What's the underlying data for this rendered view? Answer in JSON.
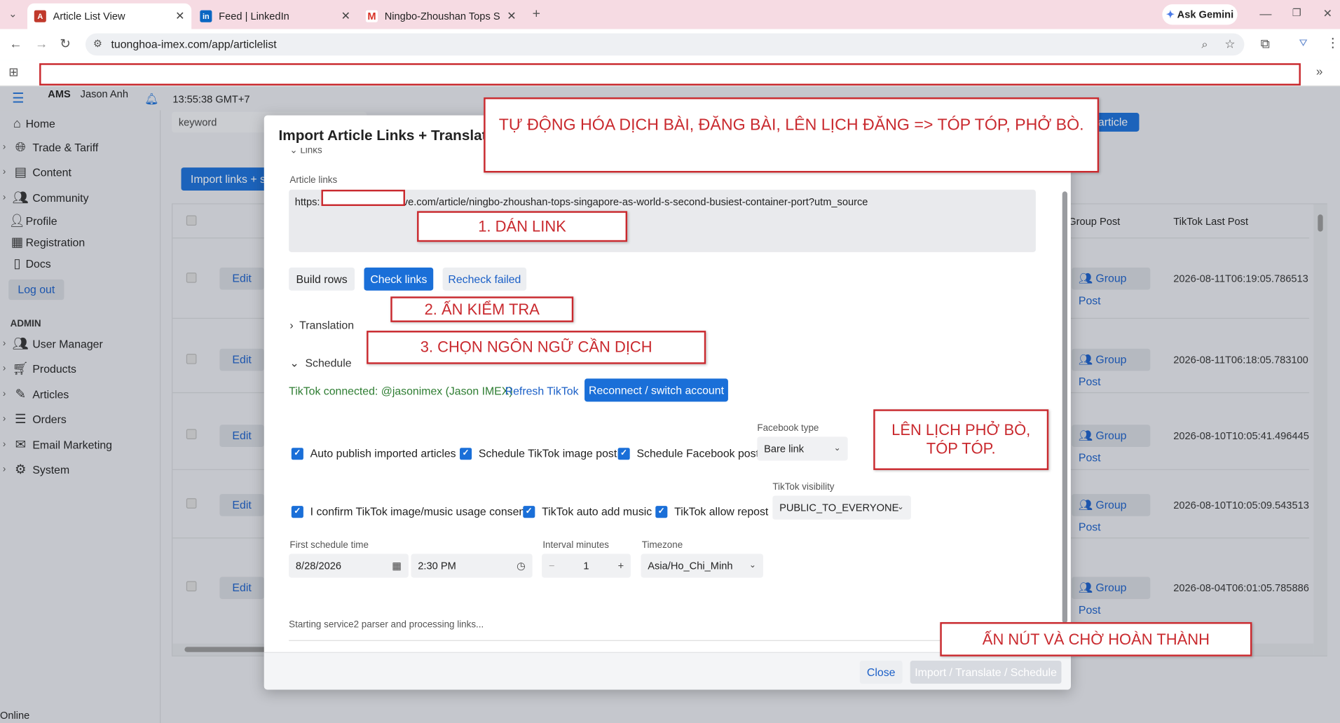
{
  "browser": {
    "tabs": [
      {
        "title": "Article List View"
      },
      {
        "title": "Feed | LinkedIn"
      },
      {
        "title": "Ningbo-Zhoushan Tops Singap"
      }
    ],
    "ask_gemini": "Ask Gemini",
    "url": "tuonghoa-imex.com/app/articlelist"
  },
  "app": {
    "brand": "AMS",
    "user": "Jason Anh",
    "clock": "13:55:38 GMT+7",
    "status": "Online"
  },
  "sidebar": {
    "items": [
      {
        "label": "Home"
      },
      {
        "label": "Trade & Tariff"
      },
      {
        "label": "Content"
      },
      {
        "label": "Community"
      },
      {
        "label": "Profile"
      },
      {
        "label": "Registration"
      },
      {
        "label": "Docs"
      }
    ],
    "logout": "Log out",
    "admin_heading": "ADMIN",
    "admin_items": [
      {
        "label": "User Manager"
      },
      {
        "label": "Products"
      },
      {
        "label": "Articles"
      },
      {
        "label": "Orders"
      },
      {
        "label": "Email Marketing"
      },
      {
        "label": "System"
      }
    ]
  },
  "list": {
    "search_placeholder": "keyword",
    "import_button": "Import links + s",
    "new_button": "article",
    "columns": {
      "group_post": "Group Post",
      "tiktok_last_post": "TikTok Last Post"
    },
    "rows": [
      {
        "edit": "Edit",
        "group_post": "Group Post",
        "tiktok_last_post": "2026-08-11T06:19:05.786513"
      },
      {
        "edit": "Edit",
        "group_post": "Group Post",
        "tiktok_last_post": "2026-08-11T06:18:05.783100"
      },
      {
        "edit": "Edit",
        "group_post": "Group Post",
        "tiktok_last_post": "2026-08-10T10:05:41.496445"
      },
      {
        "edit": "Edit",
        "group_post": "Group Post",
        "tiktok_last_post": "2026-08-10T10:05:09.543513"
      },
      {
        "edit": "Edit",
        "group_post": "Group Post",
        "tiktok_last_post": "2026-08-04T06:01:05.785886"
      }
    ]
  },
  "modal": {
    "title": "Import Article Links + Translate",
    "links_section": "Links",
    "article_links_label": "Article links",
    "link_value_prefix": "https:",
    "link_value_rest": "ve.com/article/ningbo-zhoushan-tops-singapore-as-world-s-second-busiest-container-port?utm_source",
    "build_rows": "Build rows",
    "check_links": "Check links",
    "recheck_failed": "Recheck failed",
    "translation_section": "Translation",
    "schedule_section": "Schedule",
    "tiktok_connected": "TikTok connected: @jasonimex (Jason IMEX)",
    "refresh_tiktok": "Refresh TikTok",
    "reconnect": "Reconnect / switch account",
    "auto_publish": "Auto publish imported articles",
    "schedule_tiktok": "Schedule TikTok image post",
    "schedule_facebook": "Schedule Facebook post",
    "facebook_type_label": "Facebook type",
    "facebook_type_value": "Bare link",
    "confirm_consent": "I confirm TikTok image/music usage consent",
    "auto_music": "TikTok auto add music",
    "allow_repost": "TikTok allow repost",
    "visibility_label": "TikTok visibility",
    "visibility_value": "PUBLIC_TO_EVERYONE",
    "first_schedule_label": "First schedule time",
    "date_value": "8/28/2026",
    "time_value": "2:30 PM",
    "interval_label": "Interval minutes",
    "interval_value": "1",
    "timezone_label": "Timezone",
    "timezone_value": "Asia/Ho_Chi_Minh",
    "status_text": "Starting service2 parser and processing links...",
    "close": "Close",
    "import_translate_schedule": "Import / Translate / Schedule"
  },
  "annotations": {
    "headline": "TỰ ĐỘNG HÓA DỊCH BÀI, ĐĂNG BÀI, LÊN LỊCH ĐĂNG => TÓP TÓP, PHỞ BÒ.",
    "step1": "1. DÁN LINK",
    "step2": "2. ẤN KIỂM TRA",
    "step3": "3. CHỌN NGÔN NGỮ CẦN DỊCH",
    "schedule_note": "LÊN LỊCH PHỞ BÒ, TÓP TÓP.",
    "final_note": "ẤN NÚT VÀ CHỜ HOÀN THÀNH"
  },
  "colors": {
    "primary": "#1a6fd8",
    "link": "#1a5fc7",
    "success": "#2e7d32",
    "annotation": "#c9292e"
  }
}
